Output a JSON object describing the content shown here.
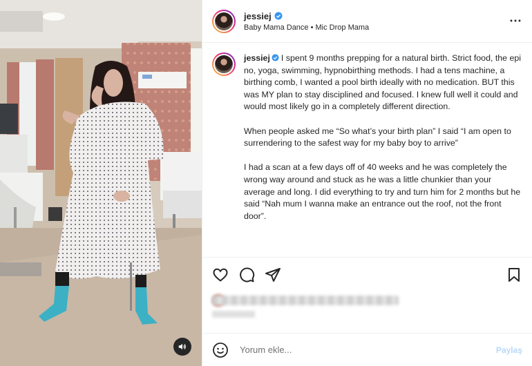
{
  "post": {
    "username": "jessiej",
    "audio": "Baby Mama Dance • Mic Drop Mama",
    "more_icon": "⋯",
    "caption": {
      "username": "jessiej",
      "p1": "I spent 9 months prepping for a natural birth. Strict food, the epi no, yoga, swimming, hypnobirthing methods. I had a tens machine, a birthing comb, I wanted a pool birth ideally with no medication. BUT this was MY plan to stay disciplined and focused. I knew full well it could and would most likely go in a completely different direction.",
      "p2": "When people asked me “So what’s your birth plan” I said “I am open to surrendering to the safest way for my baby boy to arrive”",
      "p3": "I had a scan at a few days off of 40 weeks and he was completely the wrong way around and stuck as he was a little chunkier than your average and long. I did everything to try and turn him for 2 months but he said “Nah mum I wanna make an entrance out the roof, not the front door”."
    },
    "comment": {
      "placeholder": "Yorum ekle...",
      "post_label": "Paylaş"
    }
  },
  "colors": {
    "verified": "#3897f0",
    "text": "#262626",
    "secondary": "#737373",
    "post_button": "#b8d8f8"
  }
}
